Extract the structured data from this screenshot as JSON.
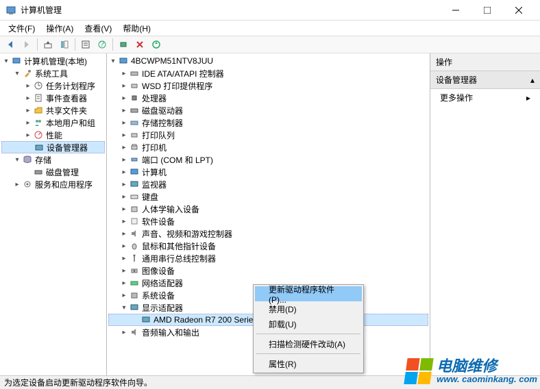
{
  "window": {
    "title": "计算机管理"
  },
  "menu": {
    "file": "文件(F)",
    "action": "操作(A)",
    "view": "查看(V)",
    "help": "帮助(H)"
  },
  "left_tree": {
    "root": "计算机管理(本地)",
    "sys_tools": "系统工具",
    "task_sched": "任务计划程序",
    "event_viewer": "事件查看器",
    "shared_folders": "共享文件夹",
    "local_users": "本地用户和组",
    "performance": "性能",
    "device_mgr": "设备管理器",
    "storage": "存储",
    "disk_mgmt": "磁盘管理",
    "services": "服务和应用程序"
  },
  "center_tree": {
    "computer": "4BCWPM51NTV8JUU",
    "ide": "IDE ATA/ATAPI 控制器",
    "wsd": "WSD 打印提供程序",
    "cpu": "处理器",
    "disk_drives": "磁盘驱动器",
    "storage_ctrl": "存储控制器",
    "print_queue": "打印队列",
    "printers": "打印机",
    "ports": "端口 (COM 和 LPT)",
    "computers": "计算机",
    "monitors": "监视器",
    "keyboards": "键盘",
    "hid": "人体学输入设备",
    "software_dev": "软件设备",
    "sound": "声音、视频和游戏控制器",
    "mouse": "鼠标和其他指针设备",
    "usb": "通用串行总线控制器",
    "imaging": "图像设备",
    "network": "网络适配器",
    "system_dev": "系统设备",
    "display": "显示适配器",
    "gpu": "AMD Radeon R7 200 Series",
    "audio_io": "音频输入和输出"
  },
  "context_menu": {
    "update_driver": "更新驱动程序软件(P)...",
    "disable": "禁用(D)",
    "uninstall": "卸载(U)",
    "scan_hw": "扫描检测硬件改动(A)",
    "properties": "属性(R)"
  },
  "right_panel": {
    "header": "操作",
    "section": "设备管理器",
    "more": "更多操作"
  },
  "statusbar": {
    "text": "为选定设备启动更新驱动程序软件向导。"
  },
  "watermark": {
    "line1": "电脑维修",
    "line2": "www. caominkang. com"
  }
}
